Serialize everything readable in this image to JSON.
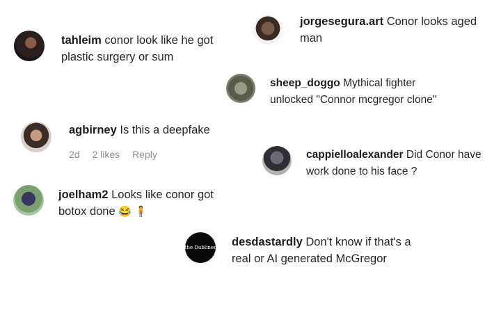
{
  "comments": [
    {
      "username": "jorgesegura.art",
      "line1": "Conor looks aged",
      "line2": "man"
    },
    {
      "username": "tahleim",
      "line1": "conor look like he got",
      "line2": "plastic surgery or sum"
    },
    {
      "username": "sheep_doggo",
      "line1": "Mythical fighter",
      "line2": "unlocked \"Connor mcgregor clone\""
    },
    {
      "username": "agbirney",
      "line1": "Is this a deepfake",
      "time": "2d",
      "likes": "2 likes",
      "reply": "Reply"
    },
    {
      "username": "cappielloalexander",
      "line1": "Did Conor have",
      "line2": "work done to his face ?"
    },
    {
      "username": "joelham2",
      "line1": "Looks like conor got",
      "line2": "botox done",
      "emoji": "😂 🧍"
    },
    {
      "username": "desdastardly",
      "line1": "Don't know if that's a",
      "line2": "real or AI generated McGregor",
      "avatar_text": "the Dubliner"
    }
  ],
  "colors": {
    "text": "#262626",
    "meta": "#8e8e8e",
    "background": "#ffffff"
  },
  "icons": {
    "avatar": "user-photo-avatar"
  }
}
